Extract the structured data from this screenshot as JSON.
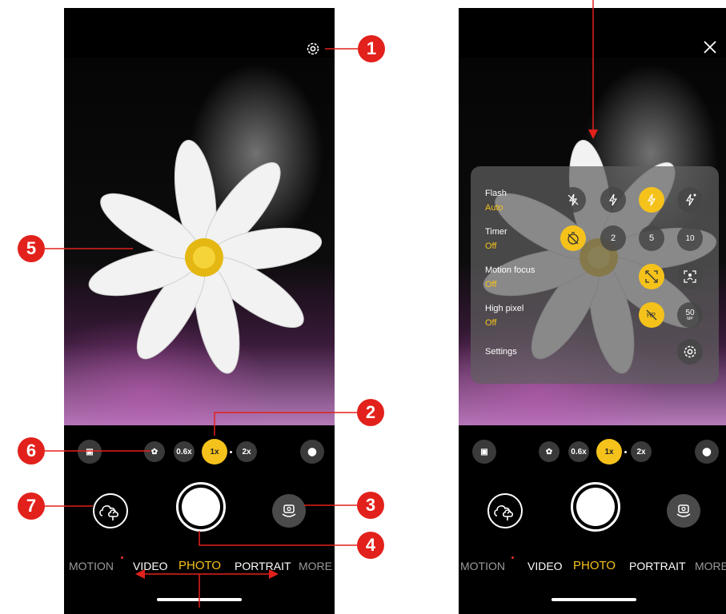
{
  "left_screen": {
    "zoom_levels": [
      "0.6x",
      "1x",
      "2x"
    ],
    "active_zoom": "1x",
    "modes": [
      "MOTION",
      "VIDEO",
      "PHOTO",
      "PORTRAIT",
      "MORE"
    ],
    "active_mode": "PHOTO"
  },
  "right_screen": {
    "zoom_levels": [
      "0.6x",
      "1x",
      "2x"
    ],
    "active_zoom": "1x",
    "modes": [
      "MOTION",
      "VIDEO",
      "PHOTO",
      "PORTRAIT",
      "MORE"
    ],
    "active_mode": "PHOTO",
    "panel": {
      "flash_label": "Flash",
      "flash_value": "Auto",
      "timer_label": "Timer",
      "timer_value": "Off",
      "timer_options": [
        "2",
        "5",
        "10"
      ],
      "motion_label": "Motion focus",
      "motion_value": "Off",
      "high_pixel_label": "High pixel",
      "high_pixel_value": "Off",
      "high_pixel_option": "50",
      "high_pixel_option_unit": "MP",
      "settings_label": "Settings"
    }
  },
  "callouts": [
    "1",
    "2",
    "3",
    "4",
    "5",
    "6",
    "7"
  ],
  "colors": {
    "accent": "#f5c21b",
    "callout": "#e2211c"
  },
  "icons": [
    "settings-gear-icon",
    "close-icon",
    "flash-off-icon",
    "flash-on-icon",
    "flash-auto-icon",
    "flash-always-icon",
    "timer-off-icon",
    "motion-focus-icon",
    "high-pixel-icon",
    "gallery-icon",
    "switch-camera-icon",
    "filter-icon",
    "macro-icon",
    "film-icon"
  ]
}
